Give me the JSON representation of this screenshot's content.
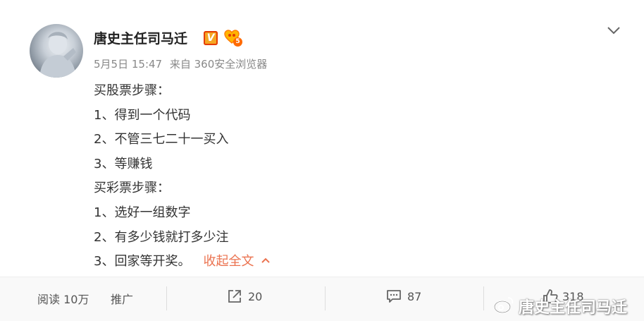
{
  "post": {
    "author": "唐史主任司马迁",
    "verified_badge": "V",
    "vip_level": "5",
    "date": "5月5日 15:47",
    "source": "来自 360安全浏览器",
    "lines": [
      "买股票步骤：",
      "1、得到一个代码",
      "2、不管三七二十一买入",
      "3、等赚钱",
      "买彩票步骤：",
      "1、选好一组数字",
      "2、有多少钱就打多少注",
      "3、回家等开奖。"
    ],
    "collapse_label": "收起全文"
  },
  "footer": {
    "reads_label": "阅读 10万",
    "promote_label": "推广",
    "repost_count": "20",
    "comment_count": "87",
    "like_count": "318"
  },
  "watermark": {
    "text": "唐史主任司马迁"
  },
  "colors": {
    "accent": "#eb7350",
    "meta": "#888888",
    "badge": "#f5a623"
  }
}
